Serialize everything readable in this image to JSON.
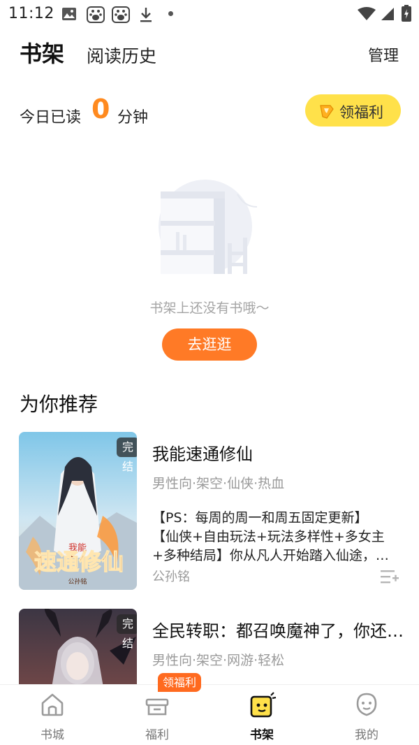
{
  "status_bar": {
    "time": "11:12",
    "icons": [
      "image-icon",
      "baidu-paw-icon",
      "baidu-paw-icon",
      "download-icon",
      "dot",
      "wifi-icon",
      "signal-icon",
      "battery-icon"
    ]
  },
  "header": {
    "active_tab": "书架",
    "history_tab": "阅读历史",
    "manage": "管理"
  },
  "reading": {
    "label": "今日已读",
    "minutes": "0",
    "unit": "分钟",
    "welfare_button": "领福利"
  },
  "empty_state": {
    "message": "书架上还没有书哦～",
    "button": "去逛逛"
  },
  "recommend": {
    "title": "为你推荐",
    "books": [
      {
        "badge": "完结",
        "title": "我能速通修仙",
        "tags": "男性向·架空·仙侠·热血",
        "description": [
          "【PS：每周的周一和周五固定更新】",
          "【仙侠+自由玩法+玩法多样性+多女主",
          "+多种结局】你从凡人开始踏入仙途，…"
        ],
        "author": "公孙铭",
        "cover_title": "速通修仙",
        "cover_prefix": "我能",
        "cover_author": "公孙铭"
      },
      {
        "badge": "完结",
        "title": "全民转职：都召唤魔神了，你还说…",
        "tags": "男性向·架空·网游·轻松"
      }
    ]
  },
  "bottom_nav": {
    "badge": "领福利",
    "items": [
      {
        "label": "书城",
        "icon": "home-icon"
      },
      {
        "label": "福利",
        "icon": "gift-box-icon"
      },
      {
        "label": "书架",
        "icon": "bookshelf-icon"
      },
      {
        "label": "我的",
        "icon": "profile-icon"
      }
    ],
    "active": "书架"
  },
  "colors": {
    "accent_orange": "#ff7a26",
    "welfare_yellow": "#ffe14a",
    "count_orange": "#ff8a1f"
  }
}
